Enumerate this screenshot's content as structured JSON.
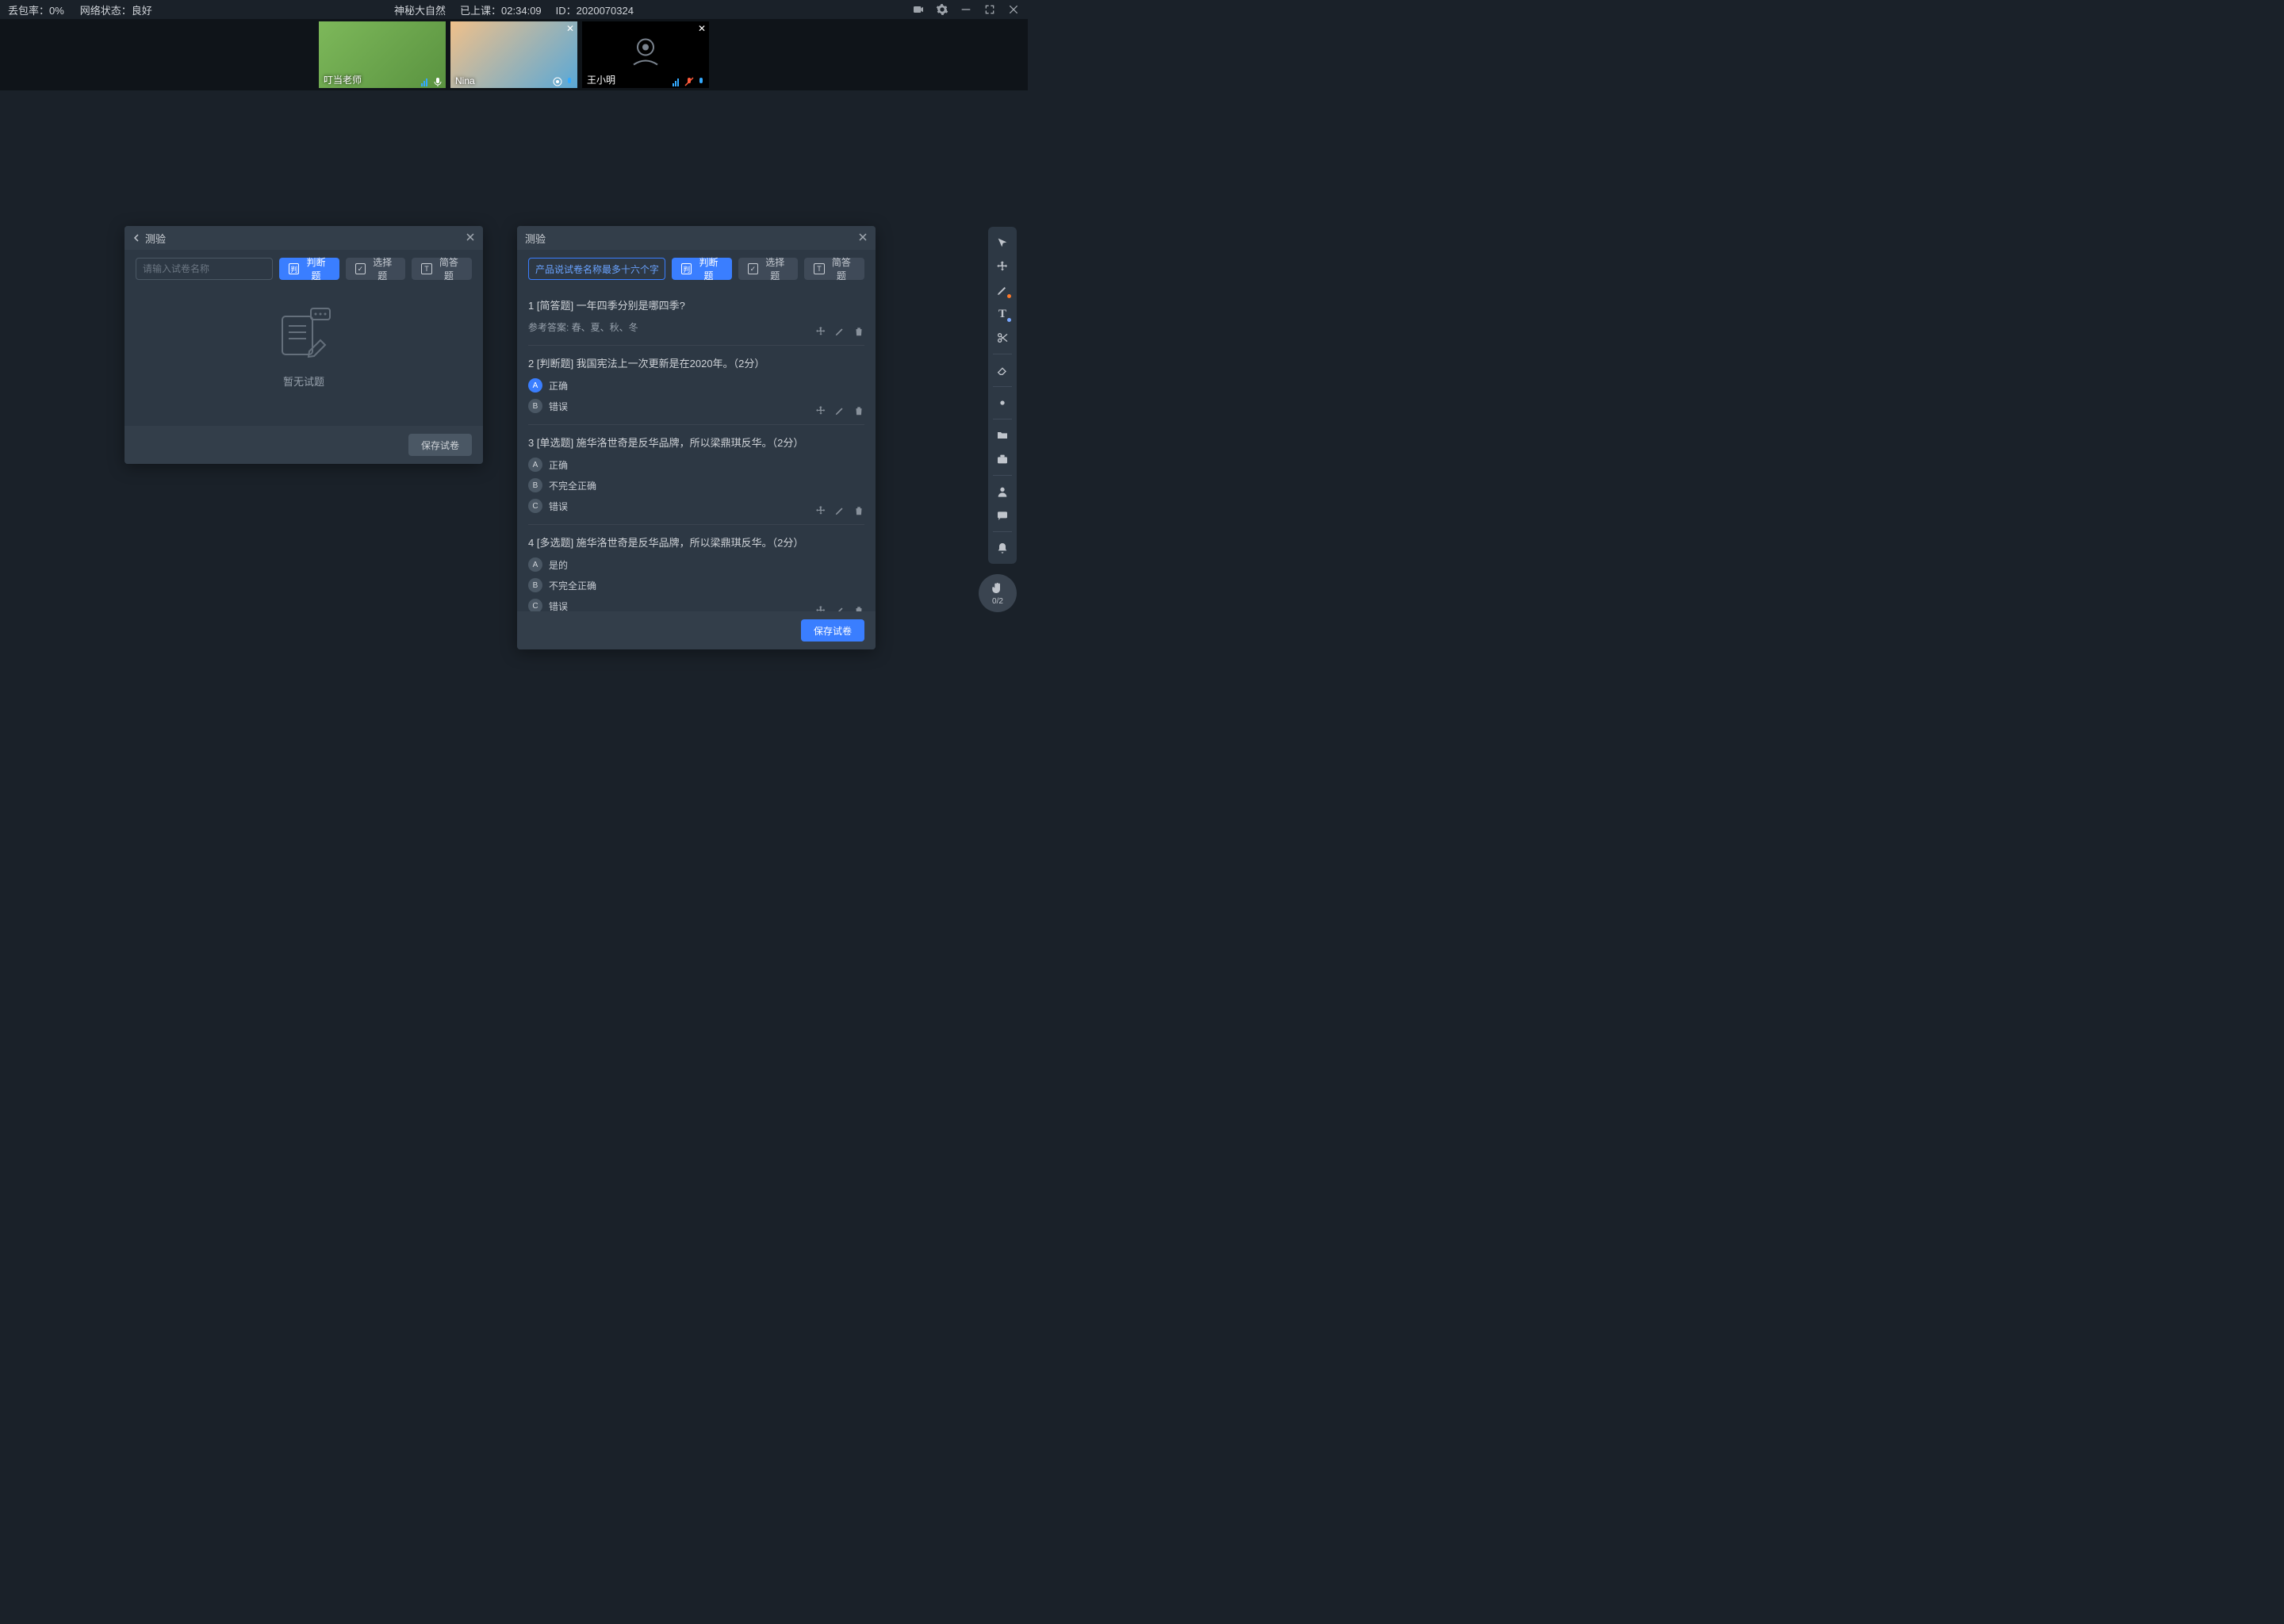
{
  "topbar": {
    "packet_loss_label": "丢包率：0%",
    "network_label": "网络状态：良好",
    "course_title": "神秘大自然",
    "elapsed_label": "已上课：02:34:09",
    "session_id_label": "ID：2020070324"
  },
  "videos": [
    {
      "name": "叮当老师",
      "camera_off": false,
      "bg": "#6aa34a"
    },
    {
      "name": "Nina",
      "camera_off": false,
      "bg": "#5aa8d6"
    },
    {
      "name": "王小明",
      "camera_off": true,
      "bg": "#000"
    }
  ],
  "panel_left": {
    "title": "测验",
    "name_placeholder": "请输入试卷名称",
    "btn_judge": "判断题",
    "btn_choice": "选择题",
    "btn_short": "简答题",
    "empty_text": "暂无试题",
    "save_label": "保存试卷"
  },
  "panel_right": {
    "title": "测验",
    "name_value": "产品说试卷名称最多十六个字",
    "btn_judge": "判断题",
    "btn_choice": "选择题",
    "btn_short": "简答题",
    "save_label": "保存试卷",
    "questions": [
      {
        "heading": "1 [简答题] 一年四季分别是哪四季?",
        "answer_ref": "参考答案: 春、夏、秋、冬",
        "options": []
      },
      {
        "heading": "2 [判断题] 我国宪法上一次更新是在2020年。（2分）",
        "options": [
          {
            "letter": "A",
            "text": "正确",
            "correct": true
          },
          {
            "letter": "B",
            "text": "错误",
            "correct": false
          }
        ]
      },
      {
        "heading": "3 [单选题] 施华洛世奇是反华品牌，所以梁鼎琪反华。（2分）",
        "options": [
          {
            "letter": "A",
            "text": "正确",
            "correct": false
          },
          {
            "letter": "B",
            "text": "不完全正确",
            "correct": false
          },
          {
            "letter": "C",
            "text": "错误",
            "correct": false
          }
        ]
      },
      {
        "heading": "4 [多选题] 施华洛世奇是反华品牌，所以梁鼎琪反华。（2分）",
        "options": [
          {
            "letter": "A",
            "text": "是的",
            "correct": false
          },
          {
            "letter": "B",
            "text": "不完全正确",
            "correct": false
          },
          {
            "letter": "C",
            "text": "错误",
            "correct": false
          }
        ]
      }
    ]
  },
  "raise_hand": {
    "count": "0/2"
  }
}
